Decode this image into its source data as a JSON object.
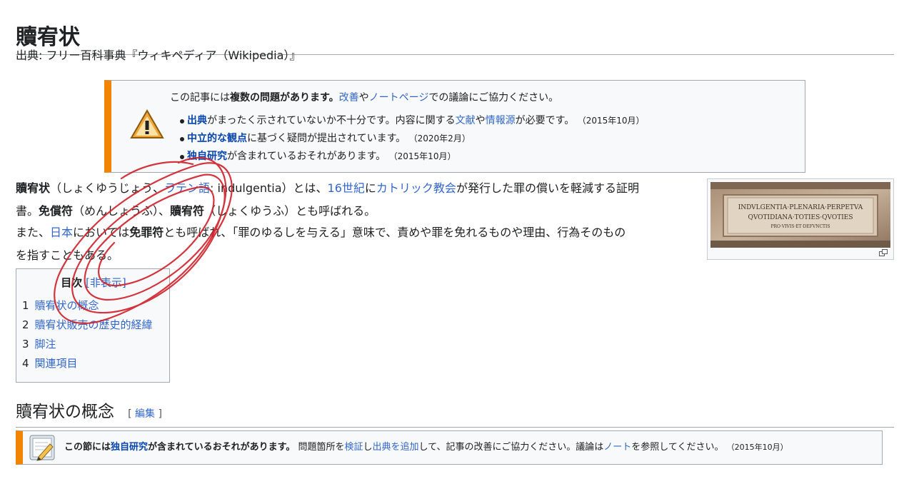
{
  "page": {
    "title": "贖宥状",
    "from": "出典: フリー百科事典『ウィキペディア（Wikipedia）』"
  },
  "issues_box": {
    "intro_pre": "この記事には",
    "intro_bold": "複数の問題があります。",
    "intro_link1": "改善",
    "intro_mid": "や",
    "intro_link2": "ノートページ",
    "intro_post": "での議論にご協力ください。",
    "items": [
      {
        "link": "出典",
        "pre_link2": "がまったく示されていないか不十分です。内容に関する",
        "link2": "文献",
        "mid": "や",
        "link3": "情報源",
        "post": "が必要です。",
        "date": "（2015年10月）"
      },
      {
        "link": "中立的な観点",
        "pre_link2": "に基づく疑問が提出されています。",
        "date": "（2020年2月）"
      },
      {
        "link": "独自研究",
        "pre_link2": "が含まれているおそれがあります。",
        "date": "（2015年10月）"
      }
    ]
  },
  "intro": {
    "p1_bold": "贖宥状",
    "p1_a": "（しょくゆうじょう、",
    "p1_link_lang": "ラテン語",
    "p1_b": ": indulgentia）とは、",
    "p1_link_century": "16世紀",
    "p1_c": "に",
    "p1_link_church": "カトリック教会",
    "p1_d": "が発行した罪の償いを軽減する証明",
    "p1_e": "書。",
    "p1_bold2": "免償符",
    "p1_f": "（めんしょうふ）、",
    "p1_bold3": "贖宥符",
    "p1_g": "（しょくゆうふ）とも呼ばれる。",
    "p2_a": "また、",
    "p2_link_japan": "日本",
    "p2_b": "においては",
    "p2_bold": "免罪符",
    "p2_c": "とも呼ばれ、「罪のゆるしを与える」意味で、責めや罪を免れるものや理由、行為そのもの",
    "p2_d": "を指すこともある。"
  },
  "image": {
    "inscription_1": "INDVLGENTIA·PLENARIA·PERPETVA",
    "inscription_2": "QVOTIDIANA·TOTIES·QVOTIES",
    "inscription_3": "PRO·VIVIS·ET·DEFVNCTIS"
  },
  "toc": {
    "title": "目次",
    "toggle": "[非表示]",
    "items": [
      {
        "num": "1",
        "label": "贖宥状の概念"
      },
      {
        "num": "2",
        "label": "贖宥状販売の歴史的経緯"
      },
      {
        "num": "3",
        "label": "脚注"
      },
      {
        "num": "4",
        "label": "関連項目"
      }
    ]
  },
  "section1": {
    "title": "贖宥状の概念",
    "edit_open": "[",
    "edit": "編集",
    "edit_close": "]"
  },
  "section_box": {
    "a": "この節には",
    "link1": "独自研究",
    "b": "が含まれているおそれがあります。",
    "c": "問題箇所を",
    "link2": "検証",
    "d": "し",
    "link3": "出典を追加",
    "e": "して、記事の改善にご協力ください。議論は",
    "link4": "ノート",
    "f": "を参照してください。",
    "date": "（2015年10月）"
  },
  "colors": {
    "link": "#3366cc",
    "accent": "#f28500",
    "scribble": "#d0202a"
  },
  "icons": [
    "warning-icon",
    "magnify-icon",
    "pencil-icon"
  ]
}
